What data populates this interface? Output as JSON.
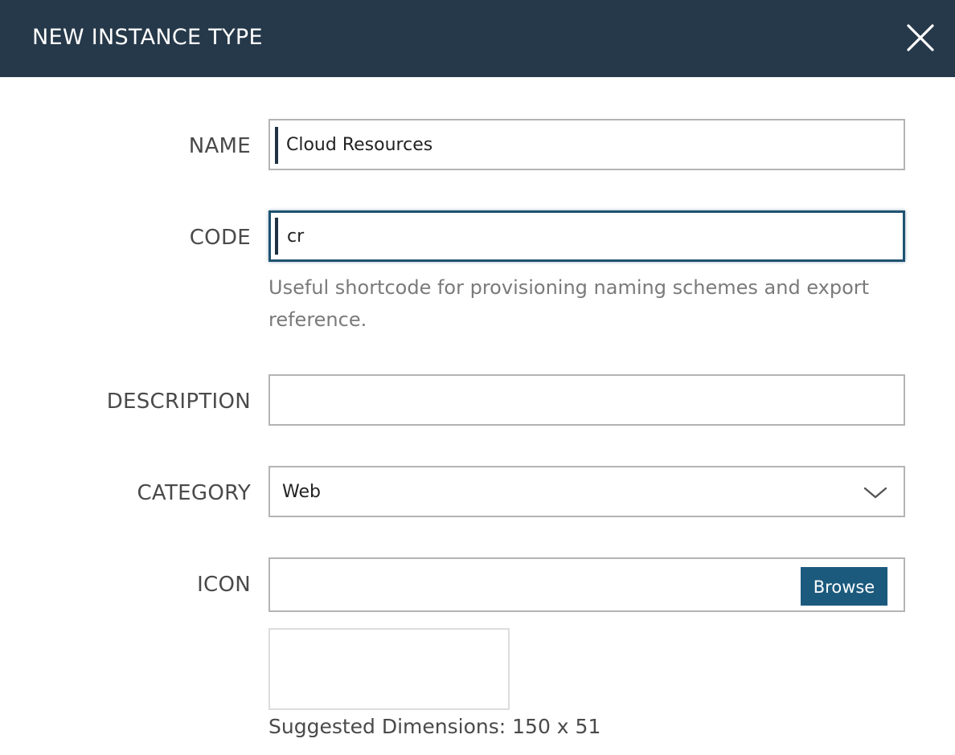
{
  "dialog": {
    "title": "NEW INSTANCE TYPE",
    "close_icon": "close-icon"
  },
  "form": {
    "name": {
      "label": "NAME",
      "value": "Cloud Resources"
    },
    "code": {
      "label": "CODE",
      "value": "cr",
      "help": "Useful shortcode for provisioning naming schemes and export reference."
    },
    "description": {
      "label": "DESCRIPTION",
      "value": ""
    },
    "category": {
      "label": "CATEGORY",
      "value": "Web",
      "icon": "chevron-down-icon"
    },
    "icon": {
      "label": "ICON",
      "browse_label": "Browse",
      "suggested_dimensions": "Suggested Dimensions: 150 x 51"
    }
  },
  "colors": {
    "header_bg": "#26394a",
    "accent": "#1c5a7d",
    "focus_border": "#1f5270"
  }
}
